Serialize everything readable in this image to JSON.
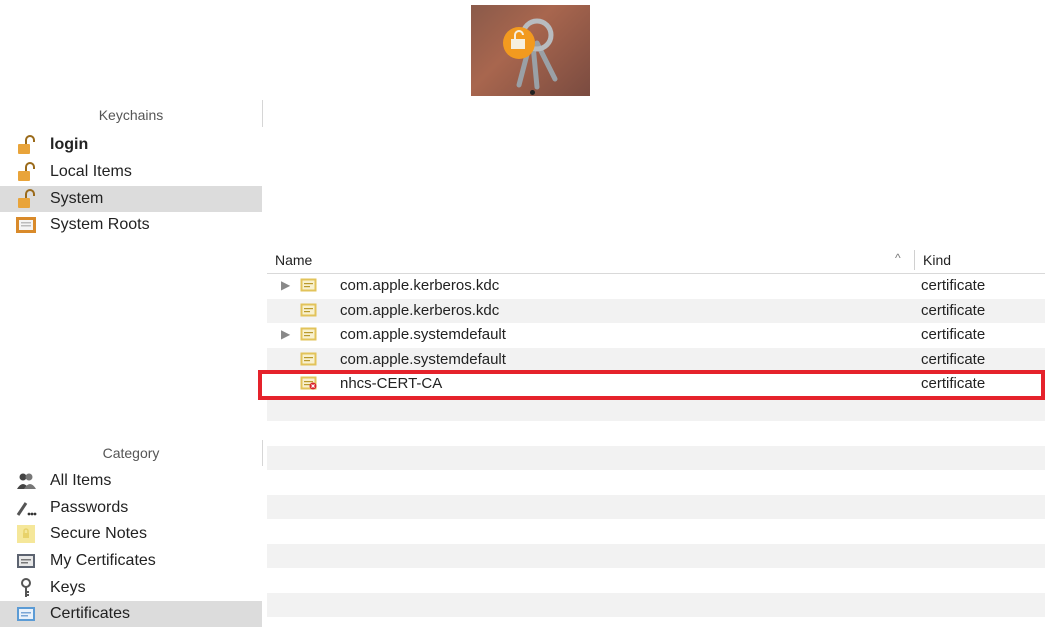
{
  "sidebar": {
    "keychains_header": "Keychains",
    "keychains": [
      {
        "label": "login",
        "icon": "unlocked-padlock-icon",
        "bold": true,
        "selected": false
      },
      {
        "label": "Local Items",
        "icon": "unlocked-padlock-icon",
        "bold": false,
        "selected": false
      },
      {
        "label": "System",
        "icon": "unlocked-padlock-icon",
        "bold": false,
        "selected": true
      },
      {
        "label": "System Roots",
        "icon": "cabinet-icon",
        "bold": false,
        "selected": false
      }
    ],
    "category_header": "Category",
    "categories": [
      {
        "label": "All Items",
        "icon": "people-icon",
        "selected": false
      },
      {
        "label": "Passwords",
        "icon": "pen-icon",
        "selected": false
      },
      {
        "label": "Secure Notes",
        "icon": "note-icon",
        "selected": false
      },
      {
        "label": "My Certificates",
        "icon": "certificate-icon",
        "selected": false
      },
      {
        "label": "Keys",
        "icon": "key-icon",
        "selected": false
      },
      {
        "label": "Certificates",
        "icon": "certificate-icon",
        "selected": true
      }
    ]
  },
  "list": {
    "col_name": "Name",
    "col_kind": "Kind",
    "sort_indicator": "^",
    "rows": [
      {
        "name": "com.apple.kerberos.kdc",
        "kind": "certificate",
        "expandable": true,
        "invalid": false
      },
      {
        "name": "com.apple.kerberos.kdc",
        "kind": "certificate",
        "expandable": false,
        "invalid": false
      },
      {
        "name": "com.apple.systemdefault",
        "kind": "certificate",
        "expandable": true,
        "invalid": false
      },
      {
        "name": "com.apple.systemdefault",
        "kind": "certificate",
        "expandable": false,
        "invalid": false
      },
      {
        "name": "nhcs-CERT-CA",
        "kind": "certificate",
        "expandable": false,
        "invalid": true
      }
    ],
    "empty_row_count": 9
  },
  "colors": {
    "highlight": "#e5222b",
    "selected_row": "#dcdcdc",
    "alt_row": "#f2f2f2",
    "cert_icon": "#e2c35a"
  }
}
